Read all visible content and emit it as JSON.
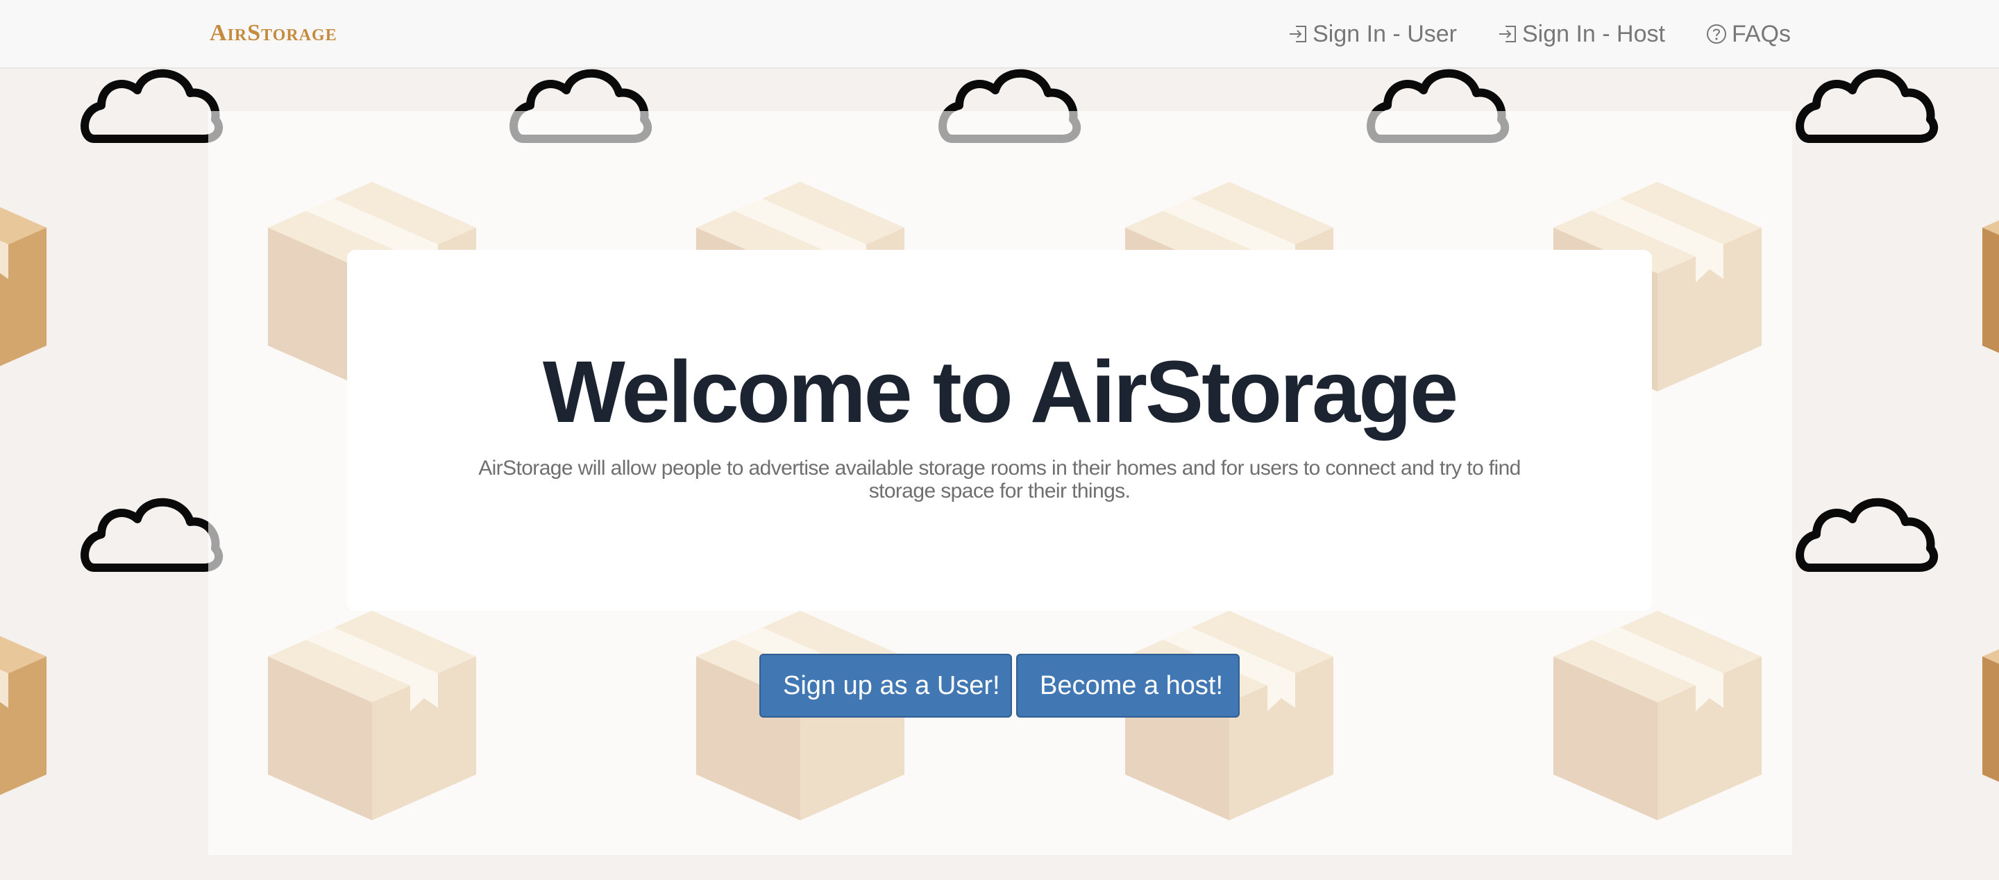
{
  "navbar": {
    "brand": "AirStorage",
    "links": [
      {
        "label": "Sign In - User",
        "icon": "sign-in-icon"
      },
      {
        "label": "Sign In - Host",
        "icon": "sign-in-icon"
      },
      {
        "label": "FAQs",
        "icon": "question-circle-icon"
      }
    ]
  },
  "jumbotron": {
    "title": "Welcome to AirStorage",
    "description": "AirStorage will allow people to advertise available storage rooms in their homes and for users to connect and try to find storage space for their things."
  },
  "actions": {
    "signup_user": "Sign up as a User!",
    "become_host": "Become a host!"
  },
  "background": {
    "pattern_icons": [
      "cloud-icon",
      "cardboard-box-icon"
    ]
  },
  "colors": {
    "brand": "#c68a3f",
    "button": "#4178b4",
    "title": "#1c2331",
    "navbar": "#f8f8f8"
  }
}
